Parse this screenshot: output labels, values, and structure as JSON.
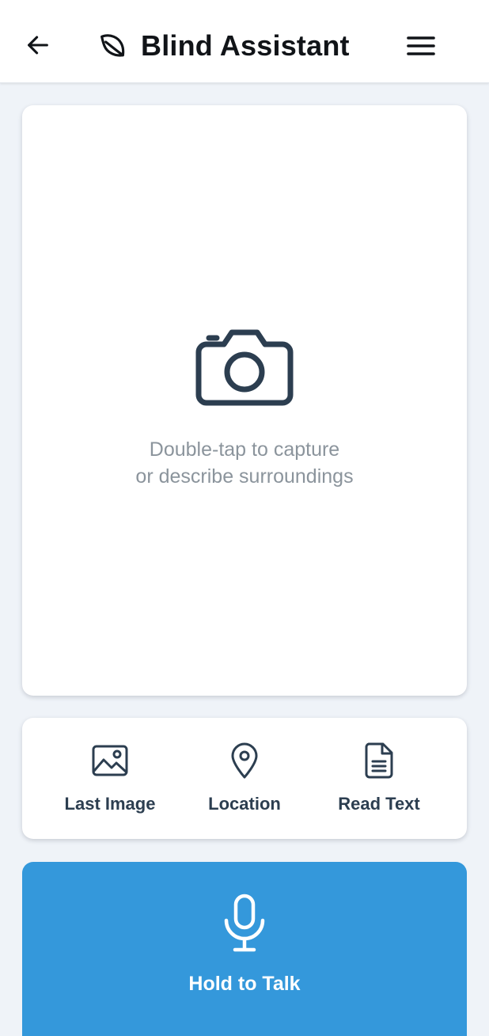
{
  "header": {
    "title": "Blind Assistant",
    "back_icon": "arrow-left-icon",
    "brand_icon": "leaf-icon",
    "menu_icon": "hamburger-menu-icon"
  },
  "camera": {
    "icon": "camera-icon",
    "hint_line1": "Double-tap to capture",
    "hint_line2": "or describe surroundings"
  },
  "actions": [
    {
      "label": "Last Image",
      "icon": "image-icon"
    },
    {
      "label": "Location",
      "icon": "map-pin-icon"
    },
    {
      "label": "Read Text",
      "icon": "document-icon"
    }
  ],
  "talk": {
    "label": "Hold to Talk",
    "icon": "microphone-icon"
  },
  "colors": {
    "background": "#eff3f8",
    "card": "#ffffff",
    "accent": "#3498db",
    "icon_dark": "#2c3e50",
    "hint_text": "#8b949c",
    "title_text": "#111418"
  }
}
